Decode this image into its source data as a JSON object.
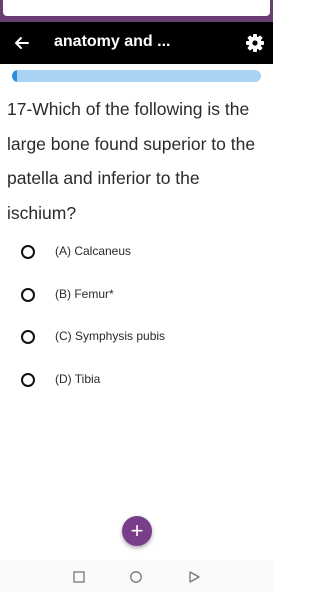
{
  "app": {
    "title": "anatomy and ...",
    "back_icon": "arrow-left-icon",
    "settings_icon": "gear-icon",
    "colors": {
      "appbar": "#000000",
      "frame": "#6b3e73",
      "accent": "#7a3d8a",
      "progress_fill": "#2b8fd9",
      "progress_track": "#a9d2f3"
    }
  },
  "progress": {
    "fraction": 0.02
  },
  "question": {
    "text": "17-Which of the following is the large bone found superior to the patella and inferior to the ischium?"
  },
  "options": [
    {
      "label": "(A) Calcaneus"
    },
    {
      "label": "(B) Femur*"
    },
    {
      "label": "(C) Symphysis pubis"
    },
    {
      "label": "(D) Tibia"
    }
  ],
  "fab": {
    "label": "+",
    "icon": "plus-icon"
  },
  "navbar": {
    "icons": [
      "recent-apps-icon",
      "home-icon",
      "back-triangle-icon"
    ]
  }
}
